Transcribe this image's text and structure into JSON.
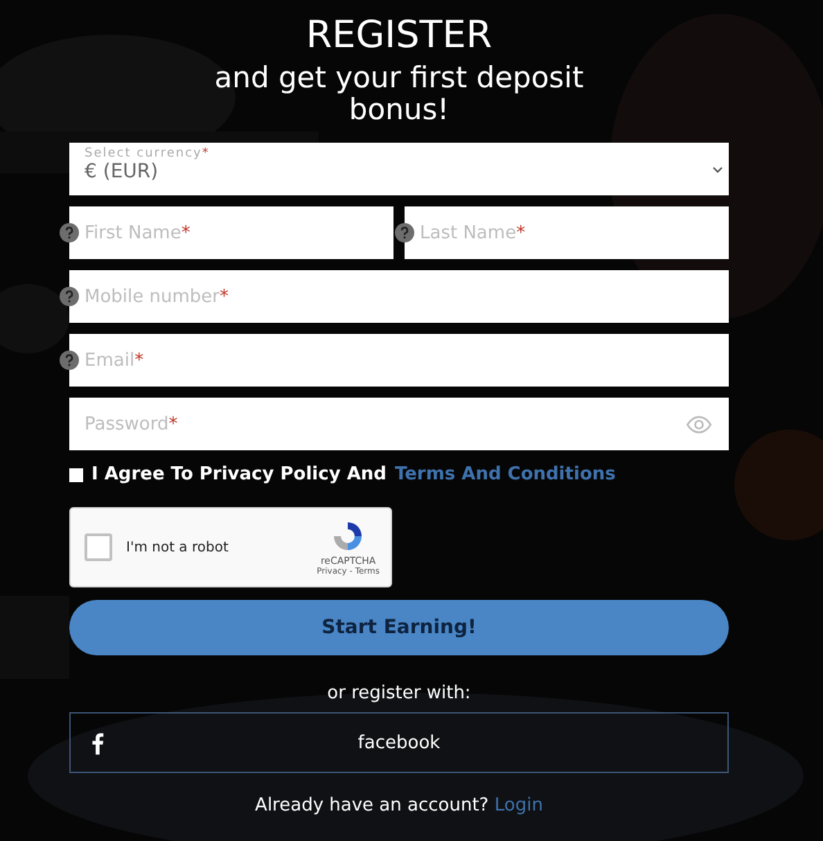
{
  "header": {
    "title": "REGISTER",
    "subtitle": "and get your first deposit bonus!"
  },
  "currency": {
    "label": "Select currency",
    "required_mark": "*",
    "value": "€ (EUR)"
  },
  "fields": [
    {
      "placeholder": "First Name",
      "required_mark": "*",
      "help": true,
      "kind": "text"
    },
    {
      "placeholder": "Last Name",
      "required_mark": "*",
      "help": true,
      "kind": "text"
    },
    {
      "placeholder": "Mobile number",
      "required_mark": "*",
      "help": true,
      "kind": "text"
    },
    {
      "placeholder": "Email",
      "required_mark": "*",
      "help": true,
      "kind": "text"
    },
    {
      "placeholder": "Password",
      "required_mark": "*",
      "help": false,
      "kind": "password"
    }
  ],
  "agree": {
    "text": "I Agree To Privacy Policy And",
    "link": "Terms And Conditions",
    "checked": false
  },
  "captcha": {
    "label": "I'm not a robot",
    "brand": "reCAPTCHA",
    "links": "Privacy - Terms",
    "checked": false
  },
  "submit": "Start Earning!",
  "alt_text": "or register with:",
  "social": [
    {
      "label": "facebook"
    }
  ],
  "footer": {
    "text": "Already have an account?",
    "link": "Login"
  }
}
